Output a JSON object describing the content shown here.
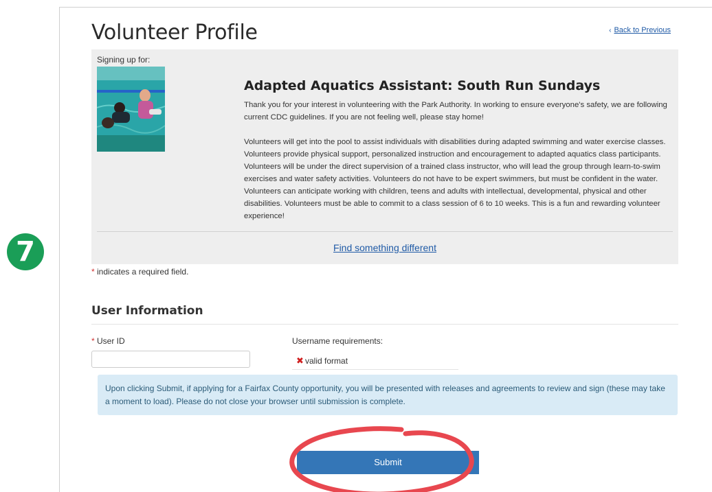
{
  "step_badge": "7",
  "header": {
    "title": "Volunteer Profile",
    "back_link": "Back to Previous"
  },
  "opportunity": {
    "signing_up_label": "Signing up for:",
    "title": "Adapted Aquatics Assistant: South Run Sundays",
    "paragraph_1": "Thank you for your interest in volunteering with the Park Authority. In working to ensure everyone's safety, we are following current CDC guidelines. If you are not feeling well, please stay home!",
    "paragraph_2": "Volunteers will get into the pool to assist individuals with disabilities during adapted swimming and water exercise classes. Volunteers provide physical support, personalized instruction and encouragement to adapted aquatics class participants. Volunteers will be under the direct supervision of a trained class instructor, who will lead the group through learn-to-swim exercises and water safety activities. Volunteers do not have to be expert swimmers, but must be confident in the water. Volunteers can anticipate working with children, teens and adults with intellectual, developmental, physical and other disabilities. Volunteers must be able to commit to a class session of 6 to 10 weeks. This is a fun and rewarding volunteer experience!",
    "find_different_link": "Find something different"
  },
  "required_note": "indicates a required field.",
  "required_star": "*",
  "user_info": {
    "section_title": "User Information",
    "user_id_label": "User ID",
    "user_id_value": "",
    "requirements_heading": "Username requirements:",
    "requirements": [
      {
        "text": "valid format",
        "status": "invalid"
      }
    ]
  },
  "info_message": "Upon clicking Submit, if applying for a Fairfax County opportunity, you will be presented with releases and agreements to review and sign (these may take a moment to load). Please do not close your browser until submission is complete.",
  "submit_label": "Submit",
  "colors": {
    "badge": "#1a9e57",
    "link": "#1f5aa6",
    "required_star": "#d03030",
    "submit_button": "#3476b7",
    "info_bg": "#d9ebf6",
    "annotation_circle": "#e8474f"
  },
  "icons": {
    "back": "chevron-left-icon",
    "requirement_status": "x-mark-icon"
  }
}
